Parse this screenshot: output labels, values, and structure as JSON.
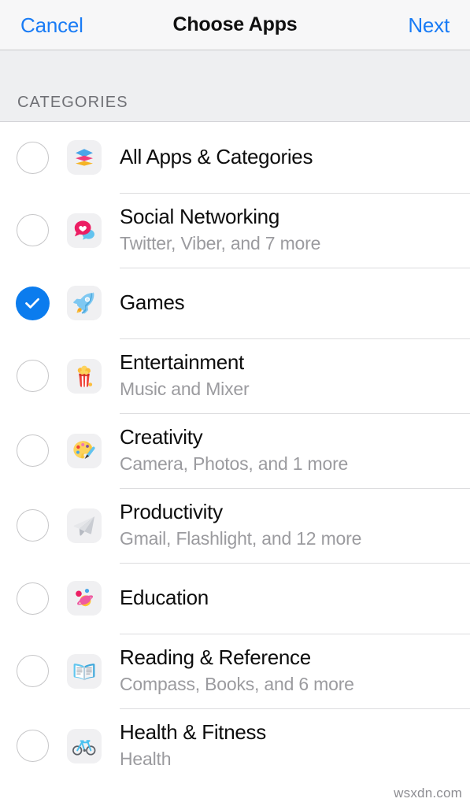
{
  "navbar": {
    "cancel_label": "Cancel",
    "title": "Choose Apps",
    "next_label": "Next"
  },
  "section": {
    "header_label": "CATEGORIES"
  },
  "colors": {
    "accent_blue": "#1a7cf5",
    "checkbox_selected": "#0b7cee",
    "checkbox_ring": "#c6c6c8",
    "title_text": "#0d0d0d",
    "subtitle_text": "#9b9b9f",
    "section_bg": "#eeeff1",
    "navbar_bg": "#f7f7f8",
    "tile_bg": "#f0f0f2",
    "separator": "#dcdcde"
  },
  "rows": [
    {
      "title": "All Apps & Categories",
      "subtitle": "",
      "selected": false,
      "icon": "stack-icon",
      "name": "all-apps-and-categories"
    },
    {
      "title": "Social Networking",
      "subtitle": "Twitter, Viber, and 7 more",
      "selected": false,
      "icon": "chat-heart-icon",
      "name": "social-networking"
    },
    {
      "title": "Games",
      "subtitle": "",
      "selected": true,
      "icon": "rocket-icon",
      "name": "games"
    },
    {
      "title": "Entertainment",
      "subtitle": "Music and Mixer",
      "selected": false,
      "icon": "popcorn-icon",
      "name": "entertainment"
    },
    {
      "title": "Creativity",
      "subtitle": "Camera, Photos, and 1 more",
      "selected": false,
      "icon": "palette-icon",
      "name": "creativity"
    },
    {
      "title": "Productivity",
      "subtitle": "Gmail, Flashlight, and 12 more",
      "selected": false,
      "icon": "paper-plane-icon",
      "name": "productivity"
    },
    {
      "title": "Education",
      "subtitle": "",
      "selected": false,
      "icon": "planet-atom-icon",
      "name": "education"
    },
    {
      "title": "Reading & Reference",
      "subtitle": "Compass, Books, and 6 more",
      "selected": false,
      "icon": "open-book-icon",
      "name": "reading-and-reference"
    },
    {
      "title": "Health & Fitness",
      "subtitle": "Health",
      "selected": false,
      "icon": "bicycle-icon",
      "name": "health-and-fitness"
    }
  ],
  "watermark": {
    "text": "wsxdn.com"
  }
}
